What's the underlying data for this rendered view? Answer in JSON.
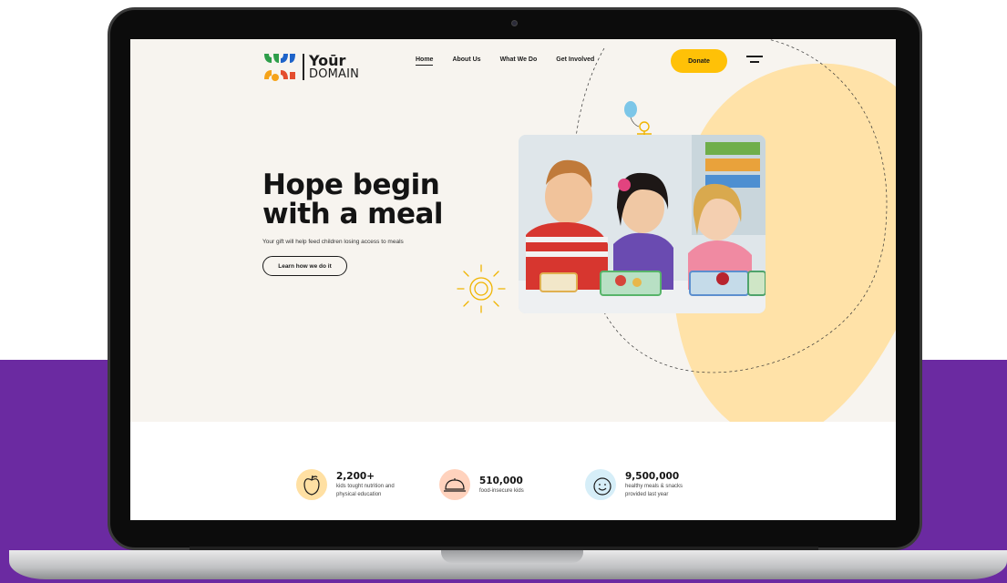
{
  "logo": {
    "line1": "Yoūr",
    "line2": "DOMAIN",
    "colors": [
      "#2e9e4a",
      "#1e63c9",
      "#f5a31a",
      "#e44d2e"
    ]
  },
  "nav": {
    "items": [
      {
        "label": "Home",
        "active": true
      },
      {
        "label": "About Us",
        "active": false
      },
      {
        "label": "What We Do",
        "active": false
      },
      {
        "label": "Get Involved",
        "active": false
      }
    ],
    "donate_label": "Donate",
    "menu_icon": "hamburger-menu-icon"
  },
  "hero": {
    "title_line1": "Hope begin",
    "title_line2": "with a meal",
    "subtitle": "Your gift will help feed children losing access to meals",
    "cta_label": "Learn how we do it",
    "image_alt": "three children eating lunch"
  },
  "stats": [
    {
      "icon": "apple-icon",
      "value": "2,200+",
      "desc_line1": "kids tought nutrition and",
      "desc_line2": "physical education",
      "color": "#ffe0a3"
    },
    {
      "icon": "food-cloche-icon",
      "value": "510,000",
      "desc_line1": "food-insecure kids",
      "desc_line2": "",
      "color": "#ffd2bd"
    },
    {
      "icon": "smiley-icon",
      "value": "9,500,000",
      "desc_line1": "healthy meals & snacks",
      "desc_line2": "provided last year",
      "color": "#d6eef8"
    }
  ],
  "colors": {
    "accent": "#ffc107",
    "screen_bg": "#f7f4ef",
    "blob": "#ffe2a8",
    "backdrop_purple": "#6b2aa1"
  }
}
